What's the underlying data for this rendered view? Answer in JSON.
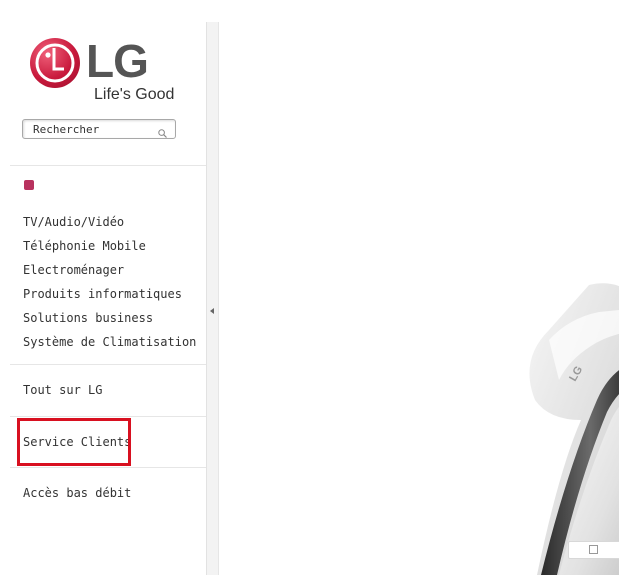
{
  "brand": {
    "name": "LG",
    "tagline": "Life's Good",
    "logo_color": "#c8193c"
  },
  "search": {
    "placeholder": "Rechercher",
    "icon": "search-icon"
  },
  "nav": {
    "products": [
      {
        "label": "TV/Audio/Vidéo"
      },
      {
        "label": "Téléphonie Mobile"
      },
      {
        "label": "Electroménager"
      },
      {
        "label": "Produits informatiques"
      },
      {
        "label": "Solutions business"
      },
      {
        "label": "Système de Climatisation"
      }
    ],
    "about": "Tout sur LG",
    "service": "Service Clients",
    "low_bandwidth": "Accès bas débit"
  },
  "colors": {
    "bullet": "#b8325e",
    "highlight": "#d81020"
  },
  "hero": {
    "phone_logo": "LG"
  }
}
